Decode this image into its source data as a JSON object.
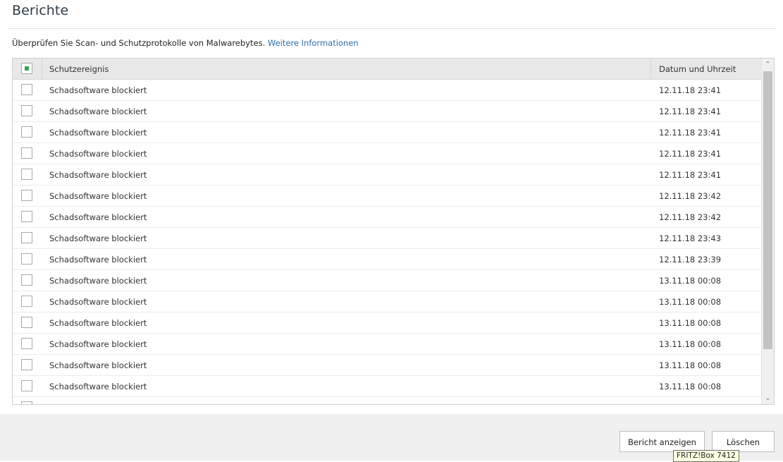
{
  "page": {
    "title": "Berichte",
    "description": "Überprüfen Sie Scan- und Schutzprotokolle von Malwarebytes.",
    "more_info_link": "Weitere Informationen"
  },
  "table": {
    "header": {
      "select_all_state": "partial",
      "event_col": "Schutzereignis",
      "date_col": "Datum und Uhrzeit"
    },
    "rows": [
      {
        "event": "Schadsoftware blockiert",
        "date": "12.11.18 23:41"
      },
      {
        "event": "Schadsoftware blockiert",
        "date": "12.11.18 23:41"
      },
      {
        "event": "Schadsoftware blockiert",
        "date": "12.11.18 23:41"
      },
      {
        "event": "Schadsoftware blockiert",
        "date": "12.11.18 23:41"
      },
      {
        "event": "Schadsoftware blockiert",
        "date": "12.11.18 23:41"
      },
      {
        "event": "Schadsoftware blockiert",
        "date": "12.11.18 23:42"
      },
      {
        "event": "Schadsoftware blockiert",
        "date": "12.11.18 23:42"
      },
      {
        "event": "Schadsoftware blockiert",
        "date": "12.11.18 23:43"
      },
      {
        "event": "Schadsoftware blockiert",
        "date": "12.11.18 23:39"
      },
      {
        "event": "Schadsoftware blockiert",
        "date": "13.11.18 00:08"
      },
      {
        "event": "Schadsoftware blockiert",
        "date": "13.11.18 00:08"
      },
      {
        "event": "Schadsoftware blockiert",
        "date": "13.11.18 00:08"
      },
      {
        "event": "Schadsoftware blockiert",
        "date": "13.11.18 00:08"
      },
      {
        "event": "Schadsoftware blockiert",
        "date": "13.11.18 00:08"
      },
      {
        "event": "Schadsoftware blockiert",
        "date": "13.11.18 00:08"
      },
      {
        "event": "",
        "date": ""
      }
    ]
  },
  "buttons": {
    "view_report": "Bericht anzeigen",
    "delete": "Löschen"
  },
  "tooltip": "FRITZ!Box 7412",
  "colors": {
    "link": "#2a6fa8",
    "check_partial": "#3aa24d",
    "footer_bg": "#f0f0f0"
  }
}
